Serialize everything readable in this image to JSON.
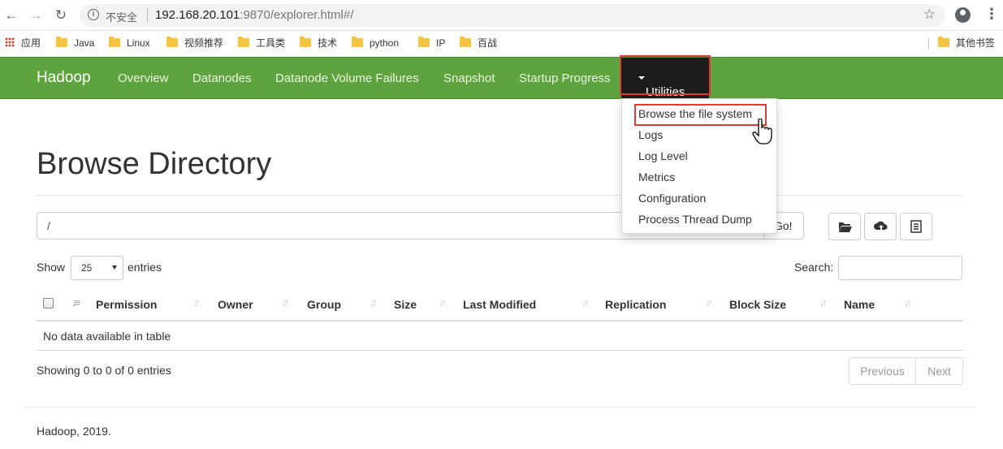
{
  "browser": {
    "back_icon": "back-arrow-icon",
    "forward_icon": "forward-arrow-icon",
    "reload_icon": "reload-icon",
    "security_label": "不安全",
    "url_host": "192.168.20.101",
    "url_rest": ":9870/explorer.html#/",
    "bookmarks": [
      "应用",
      "Java",
      "Linux",
      "视频推荐",
      "工具类",
      "技术",
      "python",
      "IP",
      "百战",
      "其他书签"
    ]
  },
  "navbar": {
    "brand": "Hadoop",
    "links": [
      "Overview",
      "Datanodes",
      "Datanode Volume Failures",
      "Snapshot",
      "Startup Progress"
    ],
    "utilities": "Utilities",
    "accent_color": "#5fa33e"
  },
  "dropdown": {
    "items": [
      "Browse the file system",
      "Logs",
      "Log Level",
      "Metrics",
      "Configuration",
      "Process Thread Dump"
    ]
  },
  "page": {
    "title": "Browse Directory",
    "path_value": "/",
    "go_label": "Go!",
    "show_label": "Show",
    "entries_value": "25",
    "entries_label": "entries",
    "search_label": "Search:",
    "columns": [
      "Permission",
      "Owner",
      "Group",
      "Size",
      "Last Modified",
      "Replication",
      "Block Size",
      "Name"
    ],
    "empty_message": "No data available in table",
    "info": "Showing 0 to 0 of 0 entries",
    "prev_label": "Previous",
    "next_label": "Next",
    "footer": "Hadoop, 2019."
  }
}
